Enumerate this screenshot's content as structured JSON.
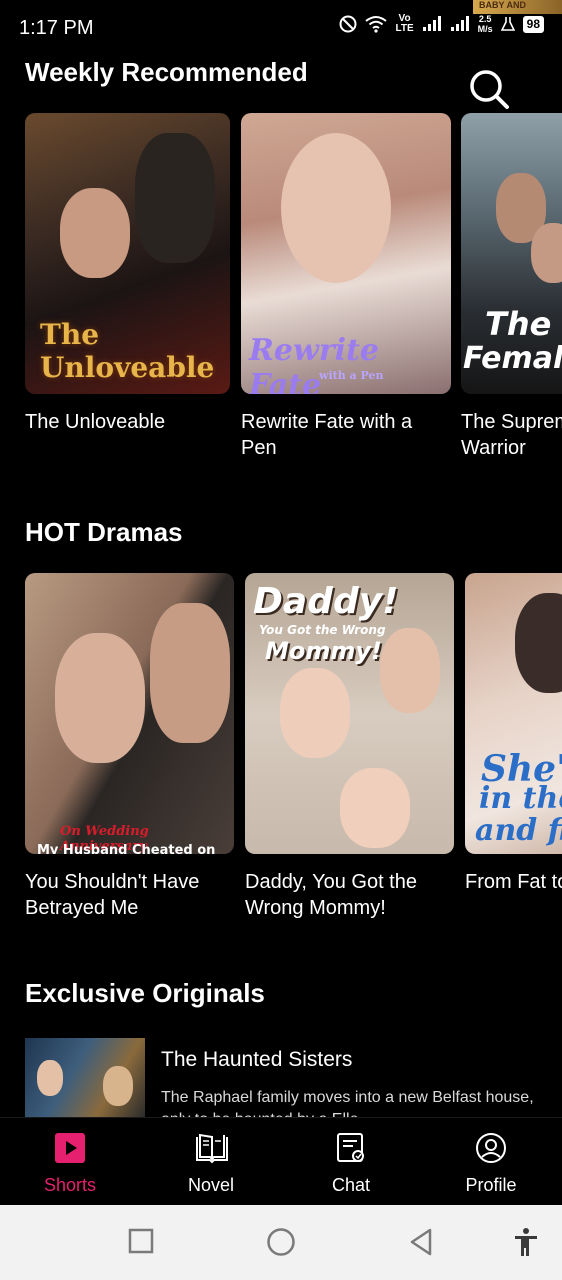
{
  "status_bar": {
    "time": "1:17 PM",
    "network_speed_value": "2.5",
    "network_speed_unit": "M/s",
    "volte_top": "Vo",
    "volte_bottom": "LTE",
    "battery": "98",
    "top_banner_text": "BABY AND"
  },
  "weekly": {
    "title": "Weekly Recommended",
    "items": [
      {
        "title": "The Unloveable",
        "poster_text": "The Unloveable"
      },
      {
        "title": "Rewrite Fate with a Pen",
        "poster_text": "Rewrite Fate",
        "poster_subtext": "with a Pen"
      },
      {
        "title": "The Supreme Female Warrior",
        "poster_text": "The Su",
        "poster_text2": "Female"
      }
    ]
  },
  "hot": {
    "title": "HOT Dramas",
    "items": [
      {
        "title": "You Shouldn't Have Betrayed Me",
        "poster_text": "On Wedding Anniversary",
        "poster_subtext": "My Husband Cheated on Me"
      },
      {
        "title": "Daddy, You Got the Wrong Mommy!",
        "poster_text": "Daddy!",
        "poster_subtext": "You Got the Wrong",
        "poster_text2": "Mommy!"
      },
      {
        "title": "From Fat to Fabulous",
        "poster_text": "She's",
        "poster_subtext": "in the",
        "poster_text2": "and fi"
      }
    ]
  },
  "originals": {
    "title": "Exclusive Originals",
    "items": [
      {
        "title": "The Haunted Sisters",
        "description": "The Raphael family moves into a new Belfast house, only to be haunted by a Elle..."
      }
    ]
  },
  "bottom_nav": {
    "items": [
      {
        "label": "Shorts",
        "icon": "play-icon",
        "active": true
      },
      {
        "label": "Novel",
        "icon": "book-icon",
        "active": false
      },
      {
        "label": "Chat",
        "icon": "chat-icon",
        "active": false
      },
      {
        "label": "Profile",
        "icon": "profile-icon",
        "active": false
      }
    ]
  },
  "colors": {
    "accent": "#e5206e",
    "background": "#000000",
    "system_nav": "#f2f2f2"
  }
}
